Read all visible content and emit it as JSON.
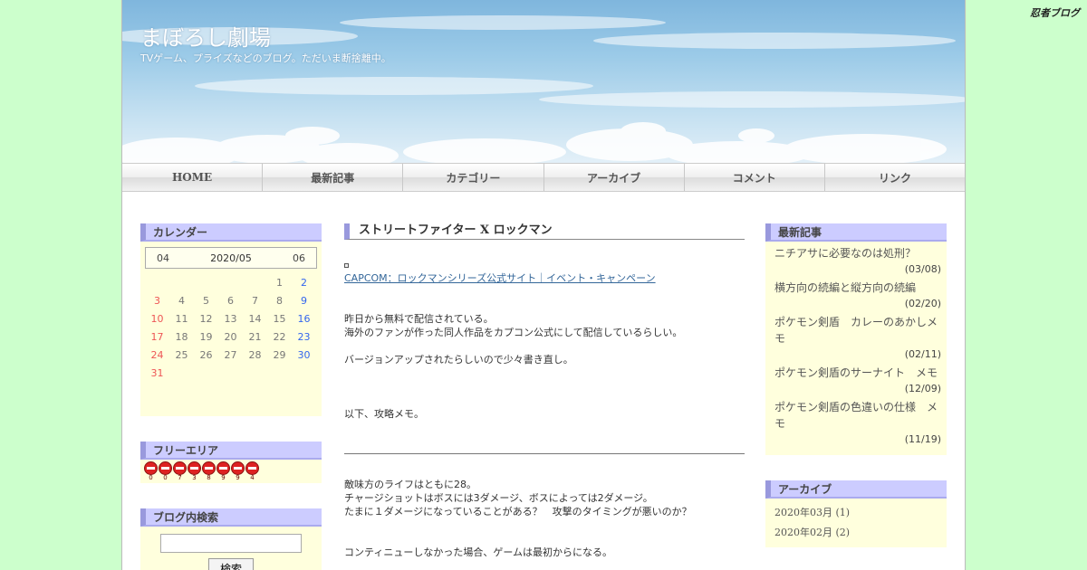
{
  "brand": {
    "logo_text": "忍者ブログ"
  },
  "site": {
    "title": "まぼろし劇場",
    "description": "TVゲーム、プライズなどのブログ。ただいま断捨離中。"
  },
  "nav": {
    "items": [
      {
        "label": "HOME"
      },
      {
        "label": "最新記事"
      },
      {
        "label": "カテゴリー"
      },
      {
        "label": "アーカイブ"
      },
      {
        "label": "コメント"
      },
      {
        "label": "リンク"
      }
    ]
  },
  "calendar": {
    "heading": "カレンダー",
    "prev": "04",
    "current": "2020/05",
    "next": "06",
    "weeks": [
      [
        "",
        "",
        "",
        "",
        "",
        "1",
        "2"
      ],
      [
        "3",
        "4",
        "5",
        "6",
        "7",
        "8",
        "9"
      ],
      [
        "10",
        "11",
        "12",
        "13",
        "14",
        "15",
        "16"
      ],
      [
        "17",
        "18",
        "19",
        "20",
        "21",
        "22",
        "23"
      ],
      [
        "24",
        "25",
        "26",
        "27",
        "28",
        "29",
        "30"
      ],
      [
        "31",
        "",
        "",
        "",
        "",
        "",
        ""
      ]
    ]
  },
  "free_area": {
    "heading": "フリーエリア",
    "counter_digits": [
      "0",
      "0",
      "7",
      "3",
      "8",
      "9",
      "9",
      "4"
    ]
  },
  "search": {
    "heading": "ブログ内検索",
    "input_value": "",
    "button_label": "検索"
  },
  "post": {
    "title": "ストリートファイター X ロックマン",
    "link_text": "CAPCOM：ロックマンシリーズ公式サイト｜イベント・キャンペーン",
    "lines": [
      "昨日から無料で配信されている。",
      "海外のファンが作った同人作品をカプコン公式にして配信しているらしい。",
      "バージョンアップされたらしいので少々書き直し。",
      "以下、攻略メモ。",
      "敵味方のライフはともに28。",
      "チャージショットはボスには3ダメージ、ボスによっては2ダメージ。",
      "たまに１ダメージになっていることがある？　攻撃のタイミングが悪いのか？",
      "コンティニューしなかった場合、ゲームは最初からになる。"
    ]
  },
  "recent": {
    "heading": "最新記事",
    "items": [
      {
        "title": "ニチアサに必要なのは処刑？",
        "date": "(03/08)"
      },
      {
        "title": "横方向の続編と縦方向の続編",
        "date": "(02/20)"
      },
      {
        "title": "ポケモン剣盾　カレーのあかしメモ",
        "date": "(02/11)"
      },
      {
        "title": "ポケモン剣盾のサーナイト　メモ",
        "date": "(12/09)"
      },
      {
        "title": "ポケモン剣盾の色違いの仕様　メモ",
        "date": "(11/19)"
      }
    ]
  },
  "archive": {
    "heading": "アーカイブ",
    "items": [
      {
        "label": "2020年03月 (1)"
      },
      {
        "label": "2020年02月 (2)"
      }
    ]
  }
}
